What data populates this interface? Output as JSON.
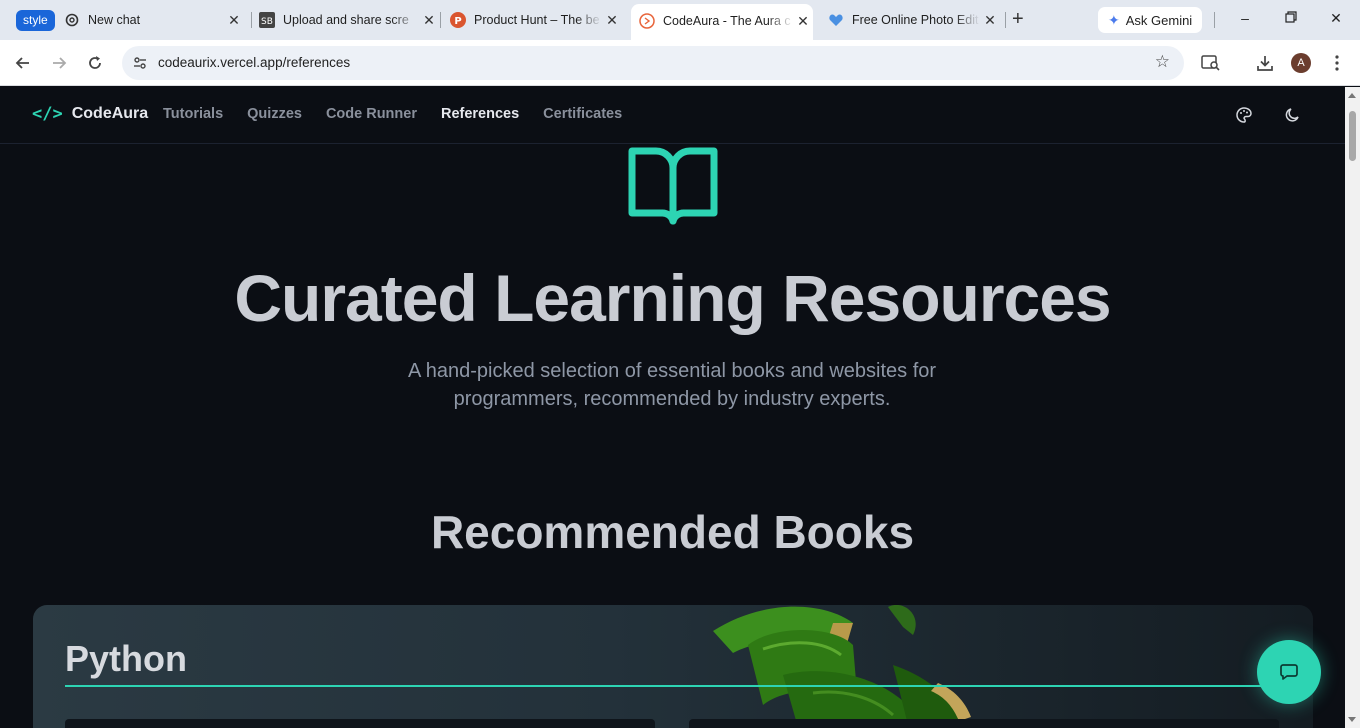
{
  "browser": {
    "style_badge": "style",
    "tabs": [
      {
        "title": "New chat",
        "icon": "openai-icon"
      },
      {
        "title": "Upload and share scre",
        "icon": "sb-icon"
      },
      {
        "title": "Product Hunt – The be",
        "icon": "producthunt-icon"
      },
      {
        "title": "CodeAura - The Aura c",
        "icon": "codeaura-icon",
        "active": true
      },
      {
        "title": "Free Online Photo Edit",
        "icon": "heart-icon"
      }
    ],
    "gemini_label": "Ask Gemini",
    "url": "codeaurix.vercel.app/references",
    "avatar_letter": "A"
  },
  "site": {
    "brand": "CodeAura",
    "nav": [
      "Tutorials",
      "Quizzes",
      "Code Runner",
      "References",
      "Certificates"
    ],
    "active_nav": "References",
    "accent": "#2dd4b3"
  },
  "hero": {
    "title": "Curated Learning Resources",
    "subtitle": "A hand-picked selection of essential books and websites for programmers, recommended by industry experts."
  },
  "books": {
    "section_title": "Recommended Books",
    "category": "Python"
  }
}
